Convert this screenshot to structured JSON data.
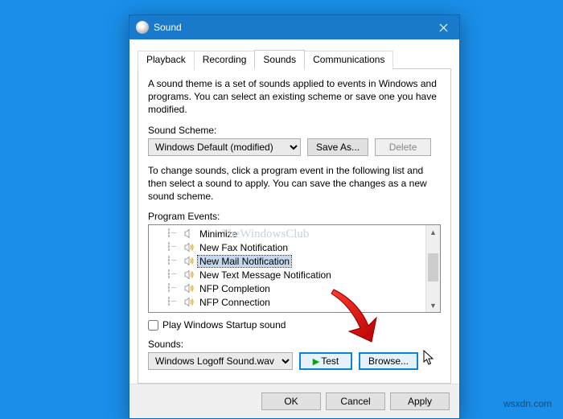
{
  "window": {
    "title": "Sound",
    "close_tooltip": "Close"
  },
  "tabs": {
    "playback": "Playback",
    "recording": "Recording",
    "sounds": "Sounds",
    "communications": "Communications"
  },
  "panel": {
    "theme_desc": "A sound theme is a set of sounds applied to events in Windows and programs.  You can select an existing scheme or save one you have modified.",
    "scheme_label": "Sound Scheme:",
    "scheme_value": "Windows Default (modified)",
    "save_as": "Save As...",
    "delete": "Delete",
    "change_desc": "To change sounds, click a program event in the following list and then select a sound to apply.  You can save the changes as a new sound scheme.",
    "events_label": "Program Events:",
    "events": [
      {
        "label": "Minimize",
        "sound": false,
        "selected": false
      },
      {
        "label": "New Fax Notification",
        "sound": true,
        "selected": false
      },
      {
        "label": "New Mail Notification",
        "sound": true,
        "selected": true
      },
      {
        "label": "New Text Message Notification",
        "sound": true,
        "selected": false
      },
      {
        "label": "NFP Completion",
        "sound": true,
        "selected": false
      },
      {
        "label": "NFP Connection",
        "sound": true,
        "selected": false
      }
    ],
    "startup_checkbox": "Play Windows Startup sound",
    "sounds_label": "Sounds:",
    "sounds_value": "Windows Logoff Sound.wav",
    "test": "Test",
    "browse": "Browse..."
  },
  "footer": {
    "ok": "OK",
    "cancel": "Cancel",
    "apply": "Apply"
  },
  "watermark": "TheWindowsClub",
  "attribution": "wsxdn.com"
}
